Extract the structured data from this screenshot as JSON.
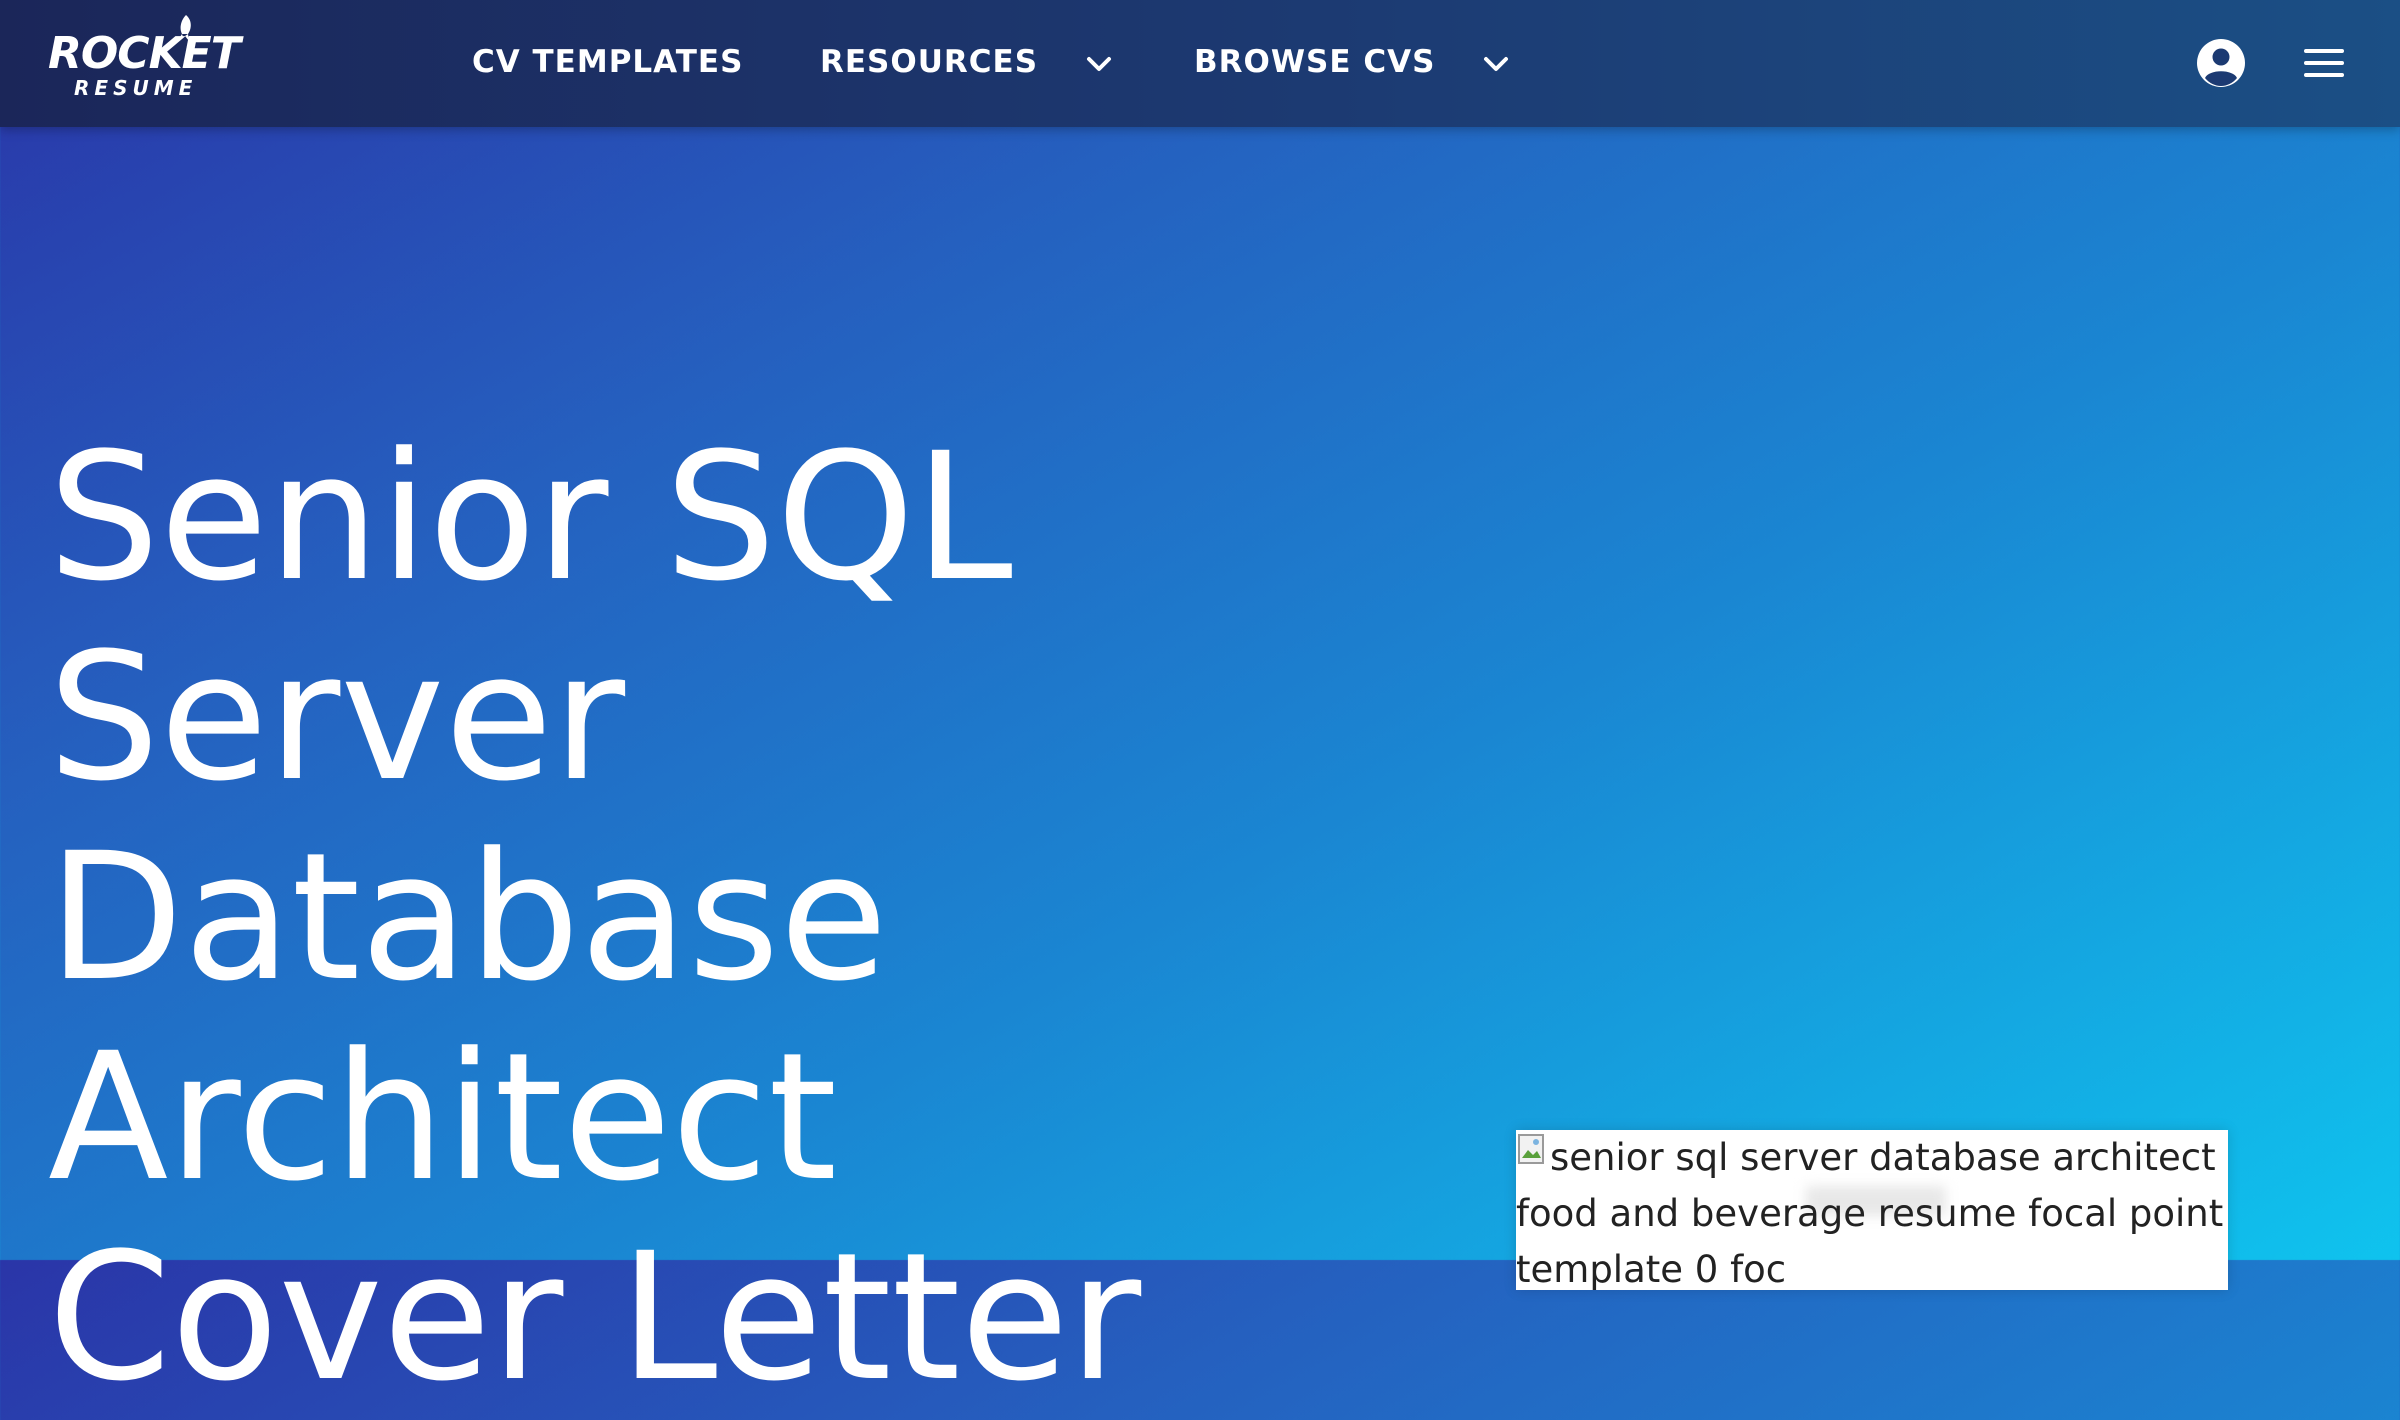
{
  "header": {
    "logo": {
      "line1": "ROCKET",
      "line2": "RESUME"
    },
    "nav": [
      {
        "label": "CV TEMPLATES",
        "has_dropdown": false
      },
      {
        "label": "RESOURCES",
        "has_dropdown": true,
        "icon": "chevron-down-icon"
      },
      {
        "label": "BROWSE CVS",
        "has_dropdown": true,
        "icon": "chevron-down-icon"
      }
    ],
    "right_icons": [
      "account-circle-icon",
      "hamburger-menu-icon"
    ]
  },
  "hero": {
    "title": "Senior SQL Server Database Architect Cover Letter"
  },
  "preview": {
    "alt_text": "senior sql server database architect food and beverage resume focal point template 0 foc"
  },
  "colors": {
    "nav_background": "#1c3a72",
    "hero_gradient_start": "#2a35a8",
    "hero_gradient_end": "#0fc3ee",
    "text_white": "#ffffff"
  }
}
